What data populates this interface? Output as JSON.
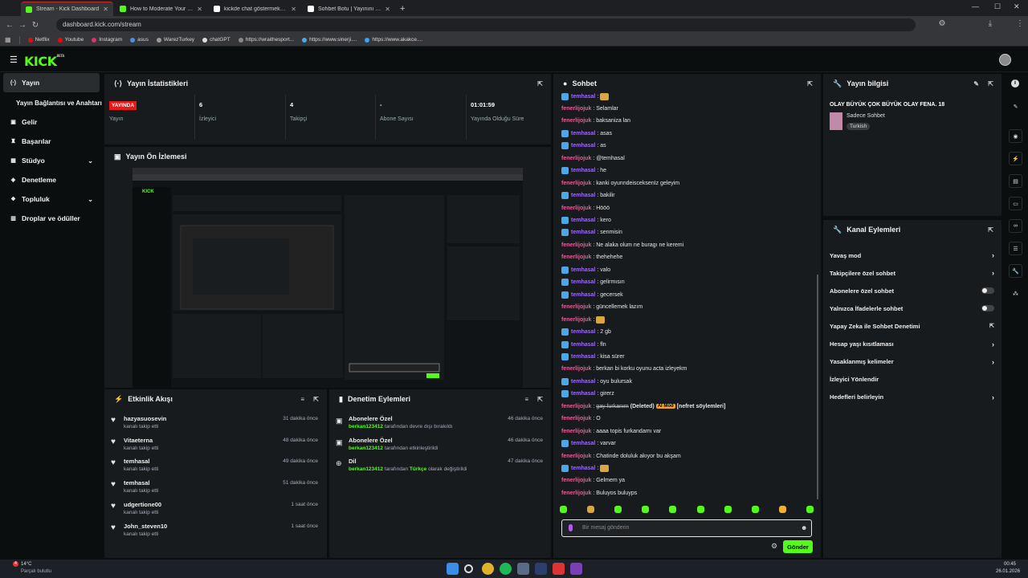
{
  "browser": {
    "tabs": [
      {
        "label": "Stream - Kick Dashboard",
        "active": true,
        "color": "#53fc18"
      },
      {
        "label": "How to Moderate Your Kick Ch",
        "active": false,
        "color": "#53fc18"
      },
      {
        "label": "kickde chat göstermek - Google",
        "active": false,
        "color": "#ffffff"
      },
      {
        "label": "Sohbet Botu | Yayınını güçlendi",
        "active": false,
        "color": "#ffffff"
      }
    ],
    "url": "dashboard.kick.com/stream",
    "bookmarks": [
      {
        "label": "Netflix",
        "color": "#e50914"
      },
      {
        "label": "Youtube",
        "color": "#ff0000"
      },
      {
        "label": "Instagram",
        "color": "#e1306c"
      },
      {
        "label": "asus",
        "color": "#4a90e2"
      },
      {
        "label": "WarezTurkey",
        "color": "#999999"
      },
      {
        "label": "chatGPT",
        "color": "#dddddd"
      },
      {
        "label": "https://wraithesport...",
        "color": "#888888"
      },
      {
        "label": "https://www.sinerji....",
        "color": "#4aa7e8"
      },
      {
        "label": "https://www.akakce....",
        "color": "#3aa0ff"
      }
    ]
  },
  "sidebar": {
    "items": [
      {
        "label": "Yayın",
        "icon": "broadcast-icon"
      },
      {
        "label": "Yayın Bağlantısı ve Anahtarı",
        "icon": ""
      },
      {
        "label": "Gelir",
        "icon": "money-icon"
      },
      {
        "label": "Başarılar",
        "icon": "trophy-icon"
      },
      {
        "label": "Stüdyo",
        "icon": "studio-icon"
      },
      {
        "label": "Denetleme",
        "icon": "shield-icon"
      },
      {
        "label": "Topluluk",
        "icon": "community-icon"
      },
      {
        "label": "Droplar ve ödüller",
        "icon": "gift-icon"
      }
    ]
  },
  "stats": {
    "title": "Yayın İstatistikleri",
    "live_badge": "YAYINDA",
    "items": [
      {
        "value": "",
        "label": "Yayın"
      },
      {
        "value": "6",
        "label": "İzleyici"
      },
      {
        "value": "4",
        "label": "Takipçi"
      },
      {
        "value": "-",
        "label": "Abone Sayısı"
      },
      {
        "value": "01:01:59",
        "label": "Yayında Olduğu Süre"
      }
    ]
  },
  "preview": {
    "title": "Yayın Ön İzlemesi"
  },
  "activity": {
    "title": "Etkinlik Akışı",
    "items": [
      {
        "name": "hazyasuosevin",
        "sub": "kanalı takip etti",
        "time": "31 dakika önce"
      },
      {
        "name": "Vitaeterna",
        "sub": "kanalı takip etti",
        "time": "48 dakika önce"
      },
      {
        "name": "temhasal",
        "sub": "kanalı takip etti",
        "time": "49 dakika önce"
      },
      {
        "name": "temhasal",
        "sub": "kanalı takip etti",
        "time": "51 dakika önce"
      },
      {
        "name": "udgertione00",
        "sub": "kanalı takip etti",
        "time": "1 saat önce"
      },
      {
        "name": "John_steven10",
        "sub": "kanalı takip etti",
        "time": "1 saat önce"
      }
    ]
  },
  "modlog": {
    "title": "Denetim Eylemleri",
    "items": [
      {
        "name": "Abonelere Özel",
        "user": "berkan123412",
        "sub": "tarafından devre dışı bırakıldı",
        "time": "46 dakika önce"
      },
      {
        "name": "Abonelere Özel",
        "user": "berkan123412",
        "sub": "tarafından etkinleştirildi",
        "time": "46 dakika önce"
      },
      {
        "name": "Dil",
        "user": "berkan123412",
        "sub": "tarafından",
        "lang": "Türkçe",
        "sub2": "olarak değiştirildi",
        "time": "47 dakika önce"
      }
    ]
  },
  "chat": {
    "title": "Sohbet",
    "colors": {
      "fenerlijojuk": "#e85d9a",
      "temhasal": "#9b6cf0"
    },
    "messages": [
      {
        "user": "temhasal",
        "text": ":",
        "emote": true
      },
      {
        "user": "fenerlijojuk",
        "text": ": Selamlar"
      },
      {
        "user": "fenerlijojuk",
        "text": ": baksaniza lan"
      },
      {
        "user": "temhasal",
        "text": ": asas"
      },
      {
        "user": "temhasal",
        "text": ": as"
      },
      {
        "user": "fenerlijojuk",
        "text": ": @temhasal"
      },
      {
        "user": "temhasal",
        "text": ": he"
      },
      {
        "user": "fenerlijojuk",
        "text": ": kanki oyunndeisceksenIz geleyim"
      },
      {
        "user": "temhasal",
        "text": ": bakilir"
      },
      {
        "user": "fenerlijojuk",
        "text": ": Hööö"
      },
      {
        "user": "temhasal",
        "text": ": kero"
      },
      {
        "user": "temhasal",
        "text": ": senmisin"
      },
      {
        "user": "fenerlijojuk",
        "text": ": Ne alaka olum ne buragı ne keremi"
      },
      {
        "user": "fenerlijojuk",
        "text": ": thehehehe"
      },
      {
        "user": "temhasal",
        "text": ": valo"
      },
      {
        "user": "temhasal",
        "text": ": gelirmısın"
      },
      {
        "user": "temhasal",
        "text": ": gecersek"
      },
      {
        "user": "fenerlijojuk",
        "text": ": güncellemek lazım"
      },
      {
        "user": "fenerlijojuk",
        "text": ":",
        "emote": true
      },
      {
        "user": "temhasal",
        "text": ": 2 gb"
      },
      {
        "user": "temhasal",
        "text": ": fln"
      },
      {
        "user": "temhasal",
        "text": ": kisa sürer"
      },
      {
        "user": "fenerlijojuk",
        "text": ": berkan bi korku oyunu acta izleyekm"
      },
      {
        "user": "temhasal",
        "text": ": oyu bulursak"
      },
      {
        "user": "temhasal",
        "text": ": girerz"
      },
      {
        "user": "fenerlijojuk",
        "text": ": ",
        "deleted": "gay furkanım",
        "deleted_tag": "(Deleted)",
        "aimod": "AI Mod",
        "reason": "[nefret söylemleri]"
      },
      {
        "user": "fenerlijojuk",
        "text": ": O"
      },
      {
        "user": "fenerlijojuk",
        "text": ": aaaa topis furkandamı var"
      },
      {
        "user": "temhasal",
        "text": ": varvar"
      },
      {
        "user": "fenerlijojuk",
        "text": ": Chatinde doluluk akıyor bu akşam"
      },
      {
        "user": "temhasal",
        "text": ":",
        "emote": true
      },
      {
        "user": "fenerlijojuk",
        "text": ": Gelmem ya"
      },
      {
        "user": "fenerlijojuk",
        "text": ": Buluyos buluyps"
      }
    ],
    "placeholder": "Bir mesaj gönderin",
    "send_label": "Gönder"
  },
  "streaminfo": {
    "title": "Yayın bilgisi",
    "stream_title": "OLAY BÜYÜK ÇOK BÜYÜK OLAY FENA. 18",
    "category": "Sadece Sohbet",
    "language": "Turkish"
  },
  "channel_actions": {
    "title": "Kanal Eylemleri",
    "items": [
      {
        "label": "Yavaş mod",
        "control": "chevron"
      },
      {
        "label": "Takipçilere özel sohbet",
        "control": "chevron"
      },
      {
        "label": "Abonelere özel sohbet",
        "control": "toggle"
      },
      {
        "label": "Yalnızca İfadelerle sohbet",
        "control": "toggle"
      },
      {
        "label": "Yapay Zeka ile Sohbet Denetimi",
        "control": "external"
      },
      {
        "label": "Hesap yaşı kısıtlaması",
        "control": "chevron"
      },
      {
        "label": "Yasaklanmış kelimeler",
        "control": "chevron"
      },
      {
        "label": "İzleyici Yönlendir",
        "control": "none"
      },
      {
        "label": "Hedefleri belirleyin",
        "control": "chevron"
      }
    ]
  },
  "taskbar": {
    "weather": "14°C",
    "weather_sub": "Parçalı bulutlu",
    "time": "00:45",
    "date": "26.01.2026",
    "notif": "4"
  },
  "accent": "#53fc18"
}
